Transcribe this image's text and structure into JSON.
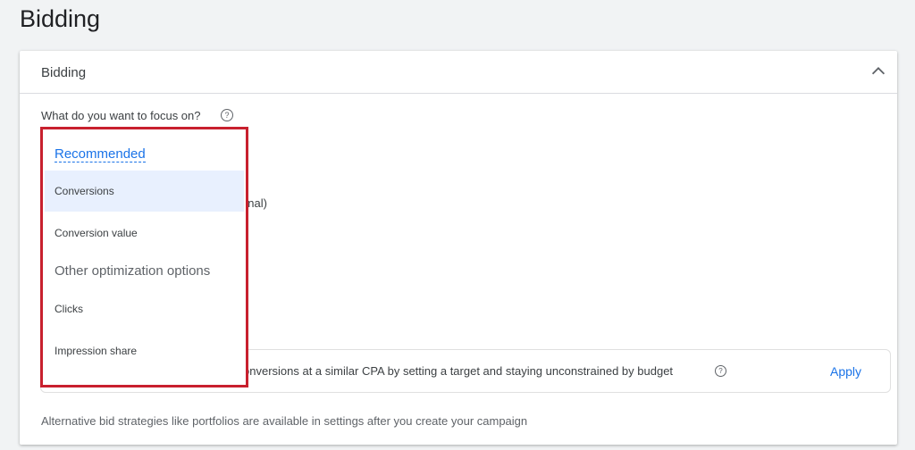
{
  "page": {
    "title": "Bidding"
  },
  "card": {
    "title": "Bidding",
    "question": "What do you want to focus on?",
    "behind_text": "onal)",
    "suggestion": {
      "text": "onversions at a similar CPA by setting a target and staying unconstrained by budget",
      "apply_label": "Apply"
    },
    "footer": "Alternative bid strategies like portfolios are available in settings after you create your campaign"
  },
  "dropdown": {
    "recommended_label": "Recommended",
    "recommended": [
      "Conversions",
      "Conversion value"
    ],
    "other_label": "Other optimization options",
    "other": [
      "Clicks",
      "Impression share"
    ],
    "selected": "Conversions"
  },
  "colors": {
    "accent": "#1a73e8",
    "highlight_border": "#c8202e",
    "selected_bg": "#e8f0fe"
  }
}
